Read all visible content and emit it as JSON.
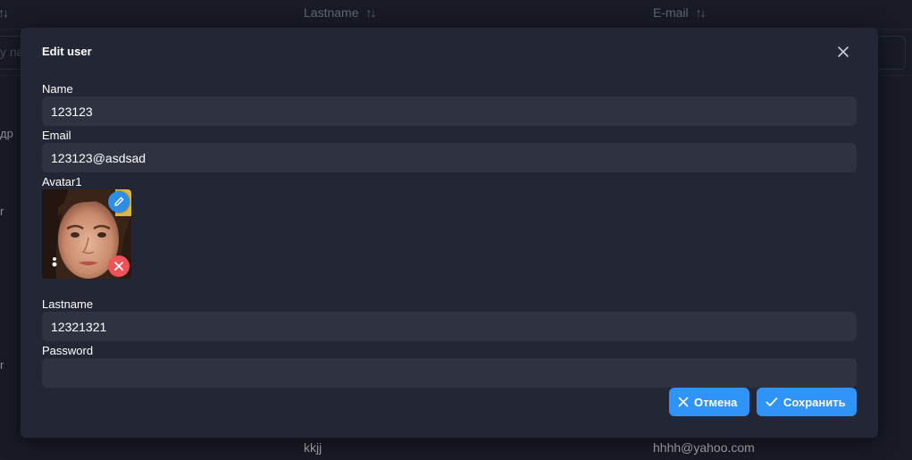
{
  "table": {
    "columns": [
      {
        "label": "Lastname"
      },
      {
        "label": "E-mail"
      }
    ],
    "filter_placeholder": "y na",
    "fragments": [
      "др",
      "r",
      "r"
    ],
    "last_row": {
      "lastname": "kkjj",
      "email": "hhhh@yahoo.com"
    }
  },
  "modal": {
    "title": "Edit user",
    "fields": {
      "name": {
        "label": "Name",
        "value": "123123"
      },
      "email": {
        "label": "Email",
        "value": "123123@asdsad"
      },
      "avatar": {
        "label": "Avatar1"
      },
      "lastname": {
        "label": "Lastname",
        "value": "12321321"
      },
      "password": {
        "label": "Password",
        "value": ""
      }
    },
    "buttons": {
      "cancel": "Отмена",
      "save": "Сохранить"
    }
  },
  "colors": {
    "accent": "#2f93f7",
    "danger": "#f0525a",
    "modal_bg": "#232634",
    "input_bg": "#2f3241"
  },
  "icons": [
    "sort-icon",
    "close-icon",
    "edit-icon",
    "remove-icon",
    "check-icon"
  ]
}
